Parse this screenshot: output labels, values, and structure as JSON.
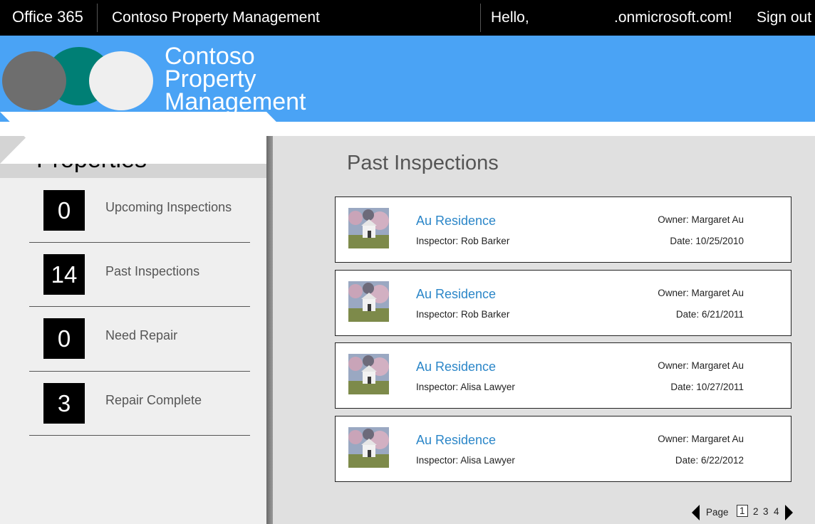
{
  "topbar": {
    "suite": "Office 365",
    "app_name": "Contoso Property Management",
    "greeting": "Hello,",
    "domain": ".onmicrosoft.com!",
    "sign_out": "Sign out"
  },
  "banner": {
    "title": "Contoso Property Management"
  },
  "sidebar": {
    "heading": "Properties",
    "items": [
      {
        "count": "0",
        "label": "Upcoming Inspections"
      },
      {
        "count": "14",
        "label": "Past Inspections"
      },
      {
        "count": "0",
        "label": "Need Repair"
      },
      {
        "count": "3",
        "label": "Repair Complete"
      }
    ]
  },
  "main": {
    "heading": "Past Inspections",
    "cards": [
      {
        "name": "Au Residence",
        "inspector": "Inspector: Rob Barker",
        "owner": "Owner: Margaret Au",
        "date": "Date: 10/25/2010"
      },
      {
        "name": "Au Residence",
        "inspector": "Inspector: Rob Barker",
        "owner": "Owner: Margaret Au",
        "date": "Date: 6/21/2011"
      },
      {
        "name": "Au Residence",
        "inspector": "Inspector: Alisa Lawyer",
        "owner": "Owner: Margaret Au",
        "date": "Date: 10/27/2011"
      },
      {
        "name": "Au Residence",
        "inspector": "Inspector: Alisa Lawyer",
        "owner": "Owner: Margaret Au",
        "date": "Date: 6/22/2012"
      }
    ]
  },
  "pager": {
    "label": "Page",
    "pages": [
      "1",
      "2",
      "3",
      "4"
    ],
    "current": "1"
  },
  "colors": {
    "banner": "#4aa3f5",
    "link": "#2b86c8",
    "teal": "#007f75"
  }
}
